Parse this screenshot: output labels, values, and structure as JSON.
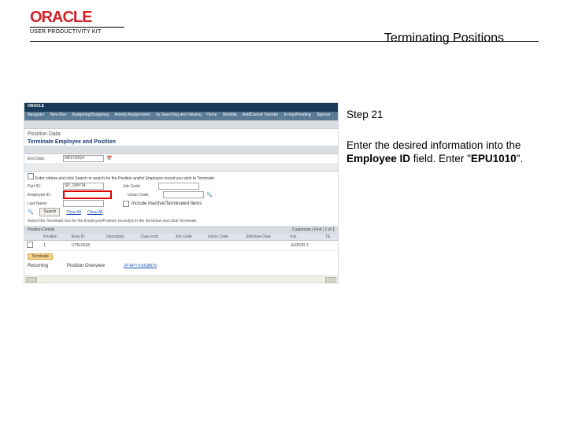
{
  "header": {
    "logo_text": "ORACLE",
    "sub_text": "USER PRODUCTIVITY KIT",
    "page_title": "Terminating Positions"
  },
  "step": {
    "label": "Step 21",
    "instruction_pre": "Enter the desired information into the ",
    "field_name": "Employee ID",
    "instruction_mid": " field. Enter \"",
    "code": "EPU1010",
    "instruction_post": "\"."
  },
  "screenshot": {
    "app": "ORACLE",
    "nav_left": [
      "Navigator",
      "New Run",
      "Budgeting/Budgeting",
      "Activity Assignments",
      "ity Searching and Viewing"
    ],
    "nav_right": [
      "Home",
      "Worklist",
      "Add/Cancel Transfer",
      "In-tray/Pending",
      "Signout"
    ],
    "section_label": "Position Data",
    "section_title": "Terminate Employee and Position",
    "filters": {
      "employee_id_label": "Employee ID:",
      "employee_id_value": "",
      "end_date_label": "End Date:",
      "end_date_value": "04/17/2014",
      "hint": "Enter criteria and click Search to search for the Position and/or Employee record you wish to Terminate",
      "part_id_label": "Part ID:",
      "part_id_value": "SP_194Y14",
      "job_code_label": "Job Code:",
      "last_name_label": "Last Name:",
      "union_code_label": "Union Code:",
      "check_label": "Include Inactive/Terminated Items",
      "search_btn": "Search",
      "clear_link": "Clear All",
      "close_link": "Close All"
    },
    "note": "Select the Terminate box for the Employee/Position record(s) in the list below and click Terminate.",
    "results_header": "Position Details",
    "results_pager": "Customize | Find |   1 of 1",
    "table": {
      "cols": [
        "",
        "Position",
        "Emp ID",
        "Descriptor",
        "Class Indc",
        "Job Code",
        "Union Code",
        "Effective Date",
        "Incl.",
        "TE"
      ],
      "row": [
        "",
        "1",
        "UTN-0018",
        "",
        "",
        "",
        "",
        "",
        "-EXPDR-T",
        ""
      ]
    },
    "terminate_btn": "Terminate",
    "return_row": {
      "returning": "Returning",
      "pos_overview": "Position Overview",
      "pos_link": "JP-RPT-#J0Q8670"
    }
  }
}
